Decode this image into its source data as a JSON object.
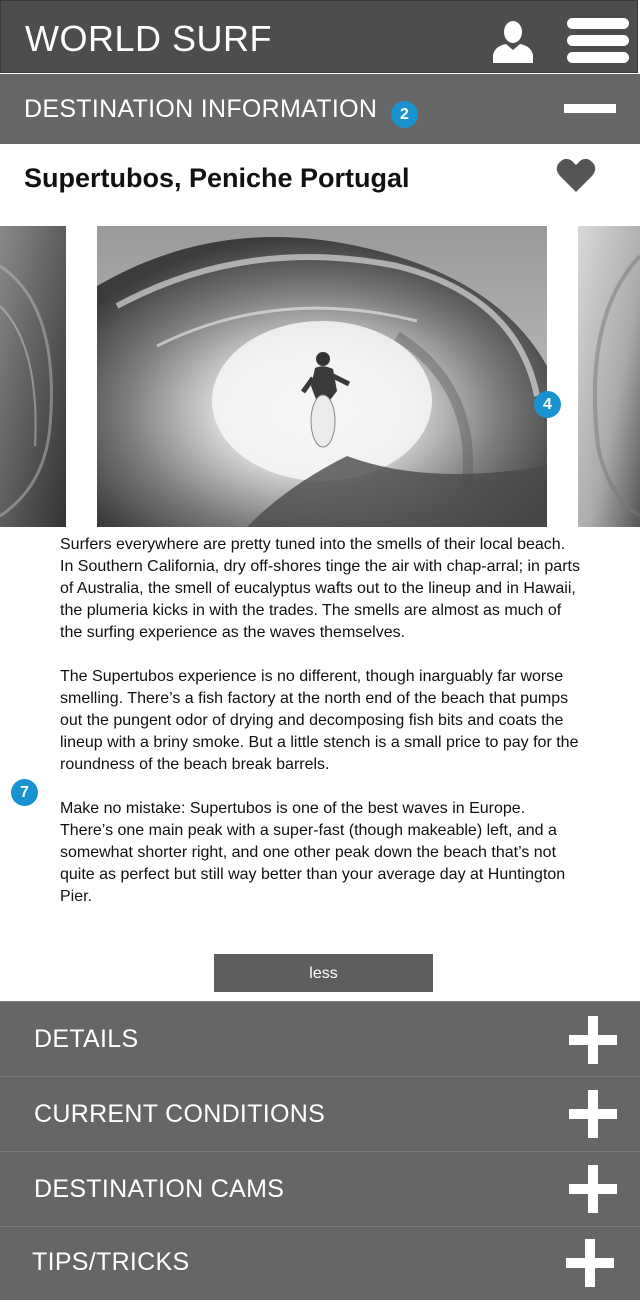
{
  "header": {
    "app_title": "WORLD SURF",
    "icons": [
      "user-icon",
      "hamburger-menu-icon"
    ]
  },
  "section": {
    "title": "DESTINATION INFORMATION",
    "badge": "2",
    "toggle_icon": "minus-icon"
  },
  "destination": {
    "name": "Supertubos, Peniche Portugal",
    "favorite_icon": "heart-icon"
  },
  "carousel": {
    "badge": "4"
  },
  "article": {
    "badge": "7",
    "paragraphs": [
      "Surfers everywhere are pretty tuned into the smells of their local beach. In Southern California, dry off-shores tinge the air with chap-arral; in parts of Australia, the smell of eucalyptus wafts out to the lineup and in Hawaii, the plumeria kicks in with the trades. The smells are almost as much of the surfing experience as the waves themselves.",
      "The Supertubos experience is no different, though inarguably far worse smelling. There’s a fish factory at the north end of the beach that pumps out the pungent odor of drying and decomposing fish bits and coats the lineup with a briny smoke. But a little stench is a small price to pay for the roundness of the beach break barrels.",
      "Make no mistake: Supertubos is one of the best waves in Europe. There’s one main peak with a super-fast (though makeable) left, and a somewhat shorter right, and one other peak down the beach that’s not quite as perfect but still way better than your average day at Huntington Pier."
    ],
    "less_label": "less"
  },
  "accordion": [
    {
      "label": "DETAILS",
      "icon": "plus-icon"
    },
    {
      "label": "CURRENT CONDITIONS",
      "icon": "plus-icon"
    },
    {
      "label": "DESTINATION CAMS",
      "icon": "plus-icon"
    },
    {
      "label": "TIPS/TRICKS",
      "icon": "plus-icon"
    }
  ],
  "colors": {
    "header_bg": "#4d4d4d",
    "section_bg": "#676767",
    "accordion_bg": "#666666",
    "badge": "#1993cf"
  }
}
